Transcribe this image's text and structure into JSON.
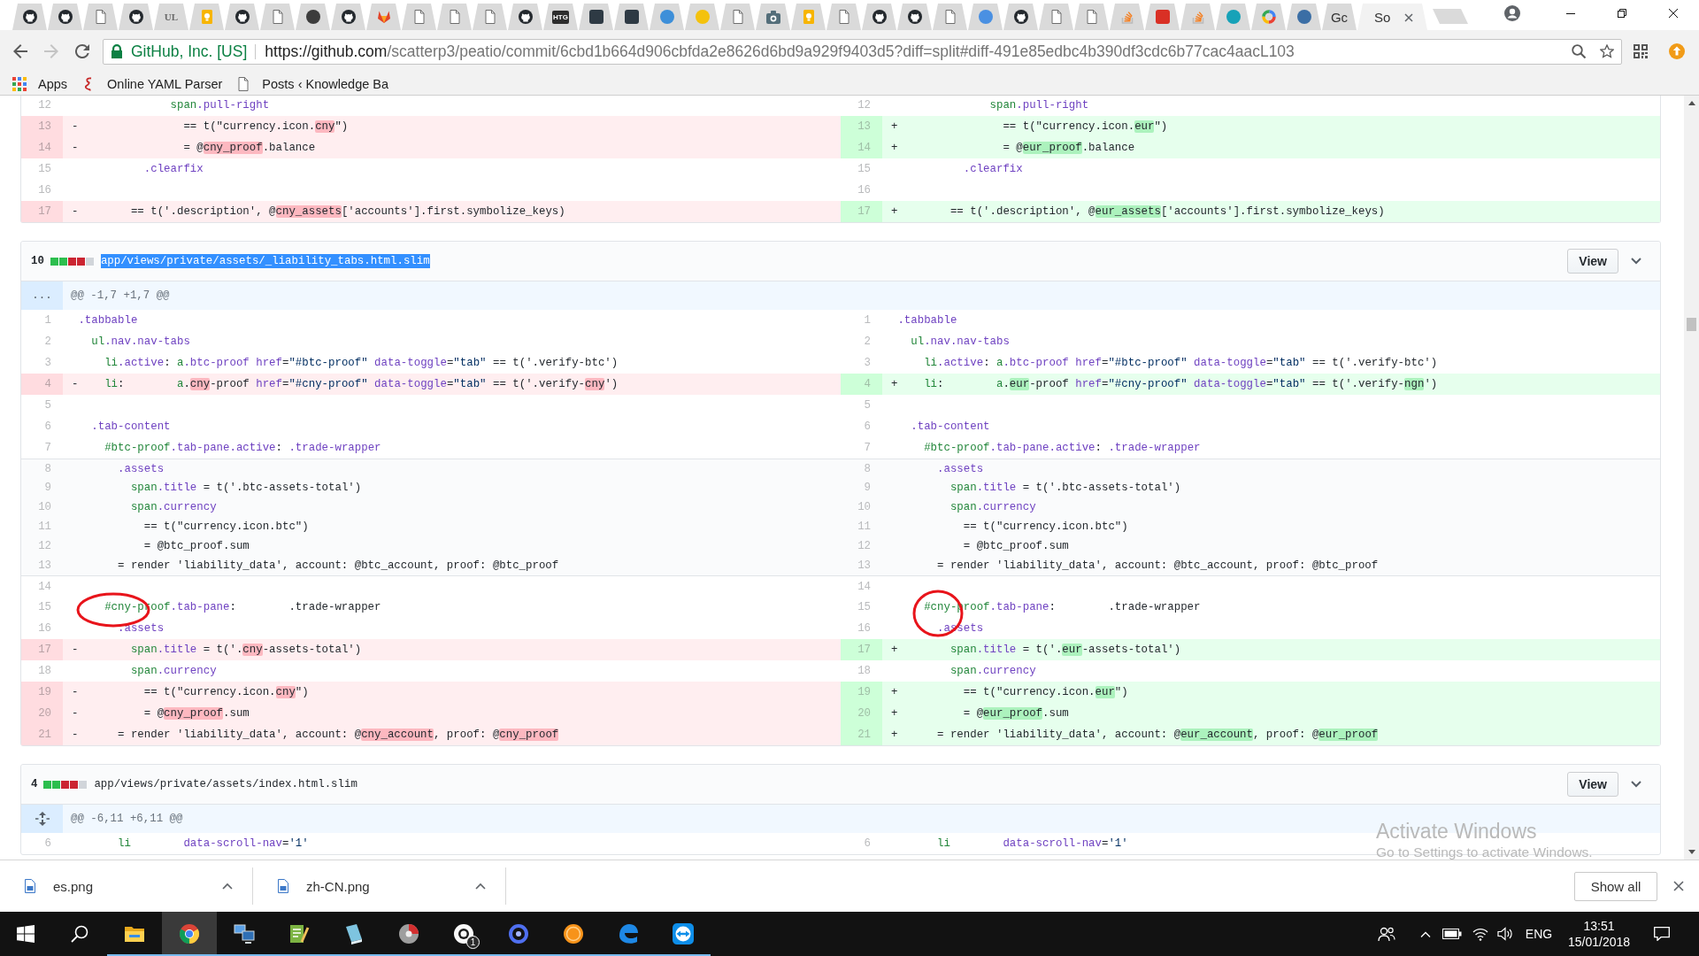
{
  "browser": {
    "tabs": [
      {
        "kind": "cat",
        "selected": false
      },
      {
        "kind": "cat",
        "selected": false
      },
      {
        "kind": "page",
        "selected": false
      },
      {
        "kind": "cat",
        "selected": false
      },
      {
        "kind": "letters",
        "glyph": "UL",
        "selected": false
      },
      {
        "kind": "note",
        "selected": false
      },
      {
        "kind": "cat",
        "selected": false
      },
      {
        "kind": "page",
        "selected": false
      },
      {
        "kind": "circle",
        "color": "#3c3c3c",
        "selected": false
      },
      {
        "kind": "cat",
        "selected": false
      },
      {
        "kind": "fox",
        "selected": false
      },
      {
        "kind": "page",
        "selected": false
      },
      {
        "kind": "page",
        "selected": false
      },
      {
        "kind": "page",
        "selected": false
      },
      {
        "kind": "cat",
        "selected": false
      },
      {
        "kind": "letters",
        "glyph": "HTG",
        "color": "#2d2d2d",
        "selected": false
      },
      {
        "kind": "square",
        "color": "#2e3a44",
        "selected": false
      },
      {
        "kind": "square",
        "color": "#2e3a44",
        "selected": false
      },
      {
        "kind": "circle",
        "color": "#3d8fd9",
        "selected": false
      },
      {
        "kind": "circle",
        "color": "#f4c20d",
        "selected": false
      },
      {
        "kind": "page",
        "selected": false
      },
      {
        "kind": "camera",
        "selected": false
      },
      {
        "kind": "note",
        "selected": false
      },
      {
        "kind": "page",
        "selected": false
      },
      {
        "kind": "cat",
        "selected": false
      },
      {
        "kind": "cat",
        "selected": false
      },
      {
        "kind": "page",
        "selected": false
      },
      {
        "kind": "circle",
        "color": "#4a90e2",
        "selected": false
      },
      {
        "kind": "cat",
        "selected": false
      },
      {
        "kind": "page",
        "selected": false
      },
      {
        "kind": "page",
        "selected": false
      },
      {
        "kind": "bars",
        "selected": false
      },
      {
        "kind": "square",
        "color": "#d93025",
        "selected": false
      },
      {
        "kind": "bars",
        "selected": false
      },
      {
        "kind": "circle",
        "color": "#17a2b8",
        "selected": false
      },
      {
        "kind": "ring",
        "selected": false
      },
      {
        "kind": "circle",
        "color": "#3b6ea5",
        "selected": false
      },
      {
        "kind": "text",
        "label": "Gc",
        "selected": false
      },
      {
        "kind": "text",
        "label": "So",
        "selected": true
      }
    ],
    "nav_buttons": [
      {
        "kind": "back",
        "disabled": false
      },
      {
        "kind": "forward",
        "disabled": true
      },
      {
        "kind": "reload",
        "disabled": false
      }
    ],
    "address_bar": {
      "secure_label": "GitHub, Inc. [US]",
      "url_host": "https://github.com",
      "url_path": "/scatterp3/peatio/commit/6cbd1b664d906cbfda2e8626d6bd9a929f9403d5?diff=split#diff-491e85edbc4b390df3cdc6b77cac4aacL103"
    },
    "bookmarks": [
      {
        "kind": "apps",
        "label": "Apps"
      },
      {
        "kind": "squiggle",
        "label": "Online YAML Parser"
      },
      {
        "kind": "page",
        "label": "Posts ‹ Knowledge Ba"
      }
    ]
  },
  "page": {
    "files": [
      {
        "rows": [
          {
            "left": {
              "number": "12",
              "kind": "context",
              "code": [
                {
                  "text": "              span",
                  "kind": "tag"
                },
                {
                  "text": ".pull-right",
                  "kind": "class"
                }
              ]
            },
            "right": {
              "number": "12",
              "kind": "context",
              "code": [
                {
                  "text": "              span",
                  "kind": "tag"
                },
                {
                  "text": ".pull-right",
                  "kind": "class"
                }
              ]
            },
            "circled": false
          },
          {
            "left": {
              "number": "13",
              "kind": "deletion",
              "marker": "-",
              "code": [
                "                == t(\"currency.icon.",
                {
                  "text": "cny",
                  "kind": "changed"
                },
                "\")"
              ]
            },
            "right": {
              "number": "13",
              "kind": "addition",
              "marker": "+",
              "code": [
                "                == t(\"currency.icon.",
                {
                  "text": "eur",
                  "kind": "changed"
                },
                "\")"
              ]
            },
            "circled": false
          },
          {
            "left": {
              "number": "14",
              "kind": "deletion",
              "marker": "-",
              "code": [
                "                = @",
                {
                  "text": "cny_proof",
                  "kind": "changed"
                },
                ".balance"
              ]
            },
            "right": {
              "number": "14",
              "kind": "addition",
              "marker": "+",
              "code": [
                "                = @",
                {
                  "text": "eur_proof",
                  "kind": "changed"
                },
                ".balance"
              ]
            },
            "circled": false
          },
          {
            "left": {
              "number": "15",
              "kind": "context",
              "code": [
                {
                  "text": "          .clearfix",
                  "kind": "class"
                }
              ]
            },
            "right": {
              "number": "15",
              "kind": "context",
              "code": [
                {
                  "text": "          .clearfix",
                  "kind": "class"
                }
              ]
            },
            "circled": false
          },
          {
            "left": {
              "number": "16",
              "kind": "context"
            },
            "right": {
              "number": "16",
              "kind": "context"
            },
            "circled": false
          },
          {
            "left": {
              "number": "17",
              "kind": "deletion",
              "marker": "-",
              "code": [
                "        == t('.description', @",
                {
                  "text": "cny_assets",
                  "kind": "changed"
                },
                "['accounts'].first.symbolize_keys)"
              ]
            },
            "right": {
              "number": "17",
              "kind": "addition",
              "marker": "+",
              "code": [
                "        == t('.description', @",
                {
                  "text": "eur_assets",
                  "kind": "changed"
                },
                "['accounts'].first.symbolize_keys)"
              ]
            },
            "circled": false
          }
        ]
      },
      {
        "header": {
          "change_count": "10",
          "diffstat": [
            {
              "color": "#2cbe4e"
            },
            {
              "color": "#2cbe4e"
            },
            {
              "color": "#cb2431"
            },
            {
              "color": "#cb2431"
            },
            {
              "color": "#d1d5da"
            }
          ],
          "path": "app/views/private/assets/_liability_tabs.html.slim",
          "text_selected": true,
          "view_button": "View"
        },
        "hunk": {
          "expander": {
            "kind": "ellipsis",
            "text": "..."
          },
          "text": "@@ -1,7 +1,7 @@"
        },
        "rows": [
          {
            "left": {
              "number": "1",
              "kind": "context",
              "code": [
                {
                  "text": ".tabbable",
                  "kind": "class"
                }
              ]
            },
            "right": {
              "number": "1",
              "kind": "context",
              "code": [
                {
                  "text": ".tabbable",
                  "kind": "class"
                }
              ]
            },
            "circled": false
          },
          {
            "left": {
              "number": "2",
              "kind": "context",
              "code": [
                {
                  "text": "  ul",
                  "kind": "tag"
                },
                {
                  "text": ".nav.nav-tabs",
                  "kind": "class"
                }
              ]
            },
            "right": {
              "number": "2",
              "kind": "context",
              "code": [
                {
                  "text": "  ul",
                  "kind": "tag"
                },
                {
                  "text": ".nav.nav-tabs",
                  "kind": "class"
                }
              ]
            },
            "circled": false
          },
          {
            "left": {
              "number": "3",
              "kind": "context",
              "code": [
                {
                  "text": "    li",
                  "kind": "tag"
                },
                {
                  "text": ".active",
                  "kind": "class"
                },
                ": ",
                {
                  "text": "a",
                  "kind": "tag"
                },
                {
                  "text": ".btc-proof",
                  "kind": "class"
                },
                {
                  "text": " href",
                  "kind": "class"
                },
                "=",
                {
                  "text": "\"#btc-proof\"",
                  "kind": "string"
                },
                {
                  "text": " data-toggle",
                  "kind": "class"
                },
                "=",
                {
                  "text": "\"tab\"",
                  "kind": "string"
                },
                " == t('.verify-btc')"
              ]
            },
            "right": {
              "number": "3",
              "kind": "context",
              "code": [
                {
                  "text": "    li",
                  "kind": "tag"
                },
                {
                  "text": ".active",
                  "kind": "class"
                },
                ": ",
                {
                  "text": "a",
                  "kind": "tag"
                },
                {
                  "text": ".btc-proof",
                  "kind": "class"
                },
                {
                  "text": " href",
                  "kind": "class"
                },
                "=",
                {
                  "text": "\"#btc-proof\"",
                  "kind": "string"
                },
                {
                  "text": " data-toggle",
                  "kind": "class"
                },
                "=",
                {
                  "text": "\"tab\"",
                  "kind": "string"
                },
                " == t('.verify-btc')"
              ]
            },
            "circled": false
          },
          {
            "left": {
              "number": "4",
              "kind": "deletion",
              "marker": "-",
              "code": [
                {
                  "text": "    li",
                  "kind": "tag"
                },
                ":        ",
                {
                  "text": "a",
                  "kind": "tag"
                },
                ".",
                {
                  "text": "cny",
                  "kind": "changed"
                },
                "-proof",
                {
                  "text": " href",
                  "kind": "class"
                },
                "=",
                {
                  "text": "\"#cny-proof\"",
                  "kind": "string"
                },
                {
                  "text": " data-toggle",
                  "kind": "class"
                },
                "=",
                {
                  "text": "\"tab\"",
                  "kind": "string"
                },
                " == t('.verify-",
                {
                  "text": "cny",
                  "kind": "changed"
                },
                "')"
              ]
            },
            "right": {
              "number": "4",
              "kind": "addition",
              "marker": "+",
              "code": [
                {
                  "text": "    li",
                  "kind": "tag"
                },
                ":        ",
                {
                  "text": "a",
                  "kind": "tag"
                },
                ".",
                {
                  "text": "eur",
                  "kind": "changed"
                },
                "-proof",
                {
                  "text": " href",
                  "kind": "class"
                },
                "=",
                {
                  "text": "\"#cny-proof\"",
                  "kind": "string"
                },
                {
                  "text": " data-toggle",
                  "kind": "class"
                },
                "=",
                {
                  "text": "\"tab\"",
                  "kind": "string"
                },
                " == t('.verify-",
                {
                  "text": "ngn",
                  "kind": "changed"
                },
                "')"
              ]
            },
            "circled": false
          },
          {
            "left": {
              "number": "5",
              "kind": "context"
            },
            "right": {
              "number": "5",
              "kind": "context"
            },
            "circled": false
          },
          {
            "left": {
              "number": "6",
              "kind": "context",
              "code": [
                {
                  "text": "  .tab-content",
                  "kind": "class"
                }
              ]
            },
            "right": {
              "number": "6",
              "kind": "context",
              "code": [
                {
                  "text": "  .tab-content",
                  "kind": "class"
                }
              ]
            },
            "circled": false
          },
          {
            "left": {
              "number": "7",
              "kind": "context",
              "code": [
                {
                  "text": "    #btc-proof",
                  "kind": "tag"
                },
                {
                  "text": ".tab-pane.active",
                  "kind": "class"
                },
                ": ",
                {
                  "text": ".trade-wrapper",
                  "kind": "class"
                }
              ]
            },
            "right": {
              "number": "7",
              "kind": "context",
              "code": [
                {
                  "text": "    #btc-proof",
                  "kind": "tag"
                },
                {
                  "text": ".tab-pane.active",
                  "kind": "class"
                },
                ": ",
                {
                  "text": ".trade-wrapper",
                  "kind": "class"
                }
              ]
            },
            "circled": false
          },
          {
            "left": {
              "number": "8",
              "kind": "expanded",
              "code": [
                {
                  "text": "      .assets",
                  "kind": "class"
                }
              ]
            },
            "right": {
              "number": "8",
              "kind": "expanded",
              "code": [
                {
                  "text": "      .assets",
                  "kind": "class"
                }
              ]
            },
            "circled": false
          },
          {
            "left": {
              "number": "9",
              "kind": "expanded",
              "code": [
                {
                  "text": "        span",
                  "kind": "tag"
                },
                {
                  "text": ".title",
                  "kind": "class"
                },
                " = t('.btc-assets-total')"
              ]
            },
            "right": {
              "number": "9",
              "kind": "expanded",
              "code": [
                {
                  "text": "        span",
                  "kind": "tag"
                },
                {
                  "text": ".title",
                  "kind": "class"
                },
                " = t('.btc-assets-total')"
              ]
            },
            "circled": false
          },
          {
            "left": {
              "number": "10",
              "kind": "expanded",
              "code": [
                {
                  "text": "        span",
                  "kind": "tag"
                },
                {
                  "text": ".currency",
                  "kind": "class"
                }
              ]
            },
            "right": {
              "number": "10",
              "kind": "expanded",
              "code": [
                {
                  "text": "        span",
                  "kind": "tag"
                },
                {
                  "text": ".currency",
                  "kind": "class"
                }
              ]
            },
            "circled": false
          },
          {
            "left": {
              "number": "11",
              "kind": "expanded",
              "code": [
                "          == t(\"currency.icon.btc\")"
              ]
            },
            "right": {
              "number": "11",
              "kind": "expanded",
              "code": [
                "          == t(\"currency.icon.btc\")"
              ]
            },
            "circled": false
          },
          {
            "left": {
              "number": "12",
              "kind": "expanded",
              "code": [
                "          = @btc_proof.sum"
              ]
            },
            "right": {
              "number": "12",
              "kind": "expanded",
              "code": [
                "          = @btc_proof.sum"
              ]
            },
            "circled": false
          },
          {
            "left": {
              "number": "13",
              "kind": "expanded",
              "code": [
                "      = render 'liability_data', account: @btc_account, proof: @btc_proof"
              ]
            },
            "right": {
              "number": "13",
              "kind": "expanded",
              "code": [
                "      = render 'liability_data', account: @btc_account, proof: @btc_proof"
              ]
            },
            "circled": false
          },
          {
            "left": {
              "number": "14",
              "kind": "context"
            },
            "right": {
              "number": "14",
              "kind": "context"
            },
            "circled": false
          },
          {
            "left": {
              "number": "15",
              "kind": "context",
              "code": [
                {
                  "text": "    #cny-proof",
                  "kind": "tag"
                },
                {
                  "text": ".tab-pane",
                  "kind": "class"
                },
                ":        .trade-wrapper"
              ]
            },
            "right": {
              "number": "15",
              "kind": "context",
              "code": [
                {
                  "text": "    #cny-proof",
                  "kind": "tag"
                },
                {
                  "text": ".tab-pane",
                  "kind": "class"
                },
                ":        .trade-wrapper"
              ]
            },
            "circled": true
          },
          {
            "left": {
              "number": "16",
              "kind": "context",
              "code": [
                {
                  "text": "      .assets",
                  "kind": "class"
                }
              ]
            },
            "right": {
              "number": "16",
              "kind": "context",
              "code": [
                {
                  "text": "      .assets",
                  "kind": "class"
                }
              ]
            },
            "circled": false
          },
          {
            "left": {
              "number": "17",
              "kind": "deletion",
              "marker": "-",
              "code": [
                {
                  "text": "        span",
                  "kind": "tag"
                },
                {
                  "text": ".title",
                  "kind": "class"
                },
                " = t('.",
                {
                  "text": "cny",
                  "kind": "changed"
                },
                "-assets-total')"
              ]
            },
            "right": {
              "number": "17",
              "kind": "addition",
              "marker": "+",
              "code": [
                {
                  "text": "        span",
                  "kind": "tag"
                },
                {
                  "text": ".title",
                  "kind": "class"
                },
                " = t('.",
                {
                  "text": "eur",
                  "kind": "changed"
                },
                "-assets-total')"
              ]
            },
            "circled": false
          },
          {
            "left": {
              "number": "18",
              "kind": "context",
              "code": [
                {
                  "text": "        span",
                  "kind": "tag"
                },
                {
                  "text": ".currency",
                  "kind": "class"
                }
              ]
            },
            "right": {
              "number": "18",
              "kind": "context",
              "code": [
                {
                  "text": "        span",
                  "kind": "tag"
                },
                {
                  "text": ".currency",
                  "kind": "class"
                }
              ]
            },
            "circled": false
          },
          {
            "left": {
              "number": "19",
              "kind": "deletion",
              "marker": "-",
              "code": [
                "          == t(\"currency.icon.",
                {
                  "text": "cny",
                  "kind": "changed"
                },
                "\")"
              ]
            },
            "right": {
              "number": "19",
              "kind": "addition",
              "marker": "+",
              "code": [
                "          == t(\"currency.icon.",
                {
                  "text": "eur",
                  "kind": "changed"
                },
                "\")"
              ]
            },
            "circled": false
          },
          {
            "left": {
              "number": "20",
              "kind": "deletion",
              "marker": "-",
              "code": [
                "          = @",
                {
                  "text": "cny_proof",
                  "kind": "changed"
                },
                ".sum"
              ]
            },
            "right": {
              "number": "20",
              "kind": "addition",
              "marker": "+",
              "code": [
                "          = @",
                {
                  "text": "eur_proof",
                  "kind": "changed"
                },
                ".sum"
              ]
            },
            "circled": false
          },
          {
            "left": {
              "number": "21",
              "kind": "deletion",
              "marker": "-",
              "code": [
                "      = render 'liability_data', account: @",
                {
                  "text": "cny_account",
                  "kind": "changed"
                },
                ", proof: @",
                {
                  "text": "cny_proof",
                  "kind": "changed"
                }
              ]
            },
            "right": {
              "number": "21",
              "kind": "addition",
              "marker": "+",
              "code": [
                "      = render 'liability_data', account: @",
                {
                  "text": "eur_account",
                  "kind": "changed"
                },
                ", proof: @",
                {
                  "text": "eur_proof",
                  "kind": "changed"
                }
              ]
            },
            "circled": false
          }
        ]
      },
      {
        "header": {
          "change_count": "4",
          "diffstat": [
            {
              "color": "#2cbe4e"
            },
            {
              "color": "#2cbe4e"
            },
            {
              "color": "#cb2431"
            },
            {
              "color": "#cb2431"
            },
            {
              "color": "#d1d5da"
            }
          ],
          "path": "app/views/private/assets/index.html.slim",
          "text_selected": false,
          "view_button": "View"
        },
        "hunk": {
          "expander": {
            "kind": "unfold"
          },
          "text": "@@ -6,11 +6,11 @@"
        },
        "rows": [
          {
            "left": {
              "number": "6",
              "kind": "context",
              "code": [
                {
                  "text": "      li",
                  "kind": "tag"
                },
                {
                  "text": "        data-scroll-nav",
                  "kind": "class"
                },
                "=",
                {
                  "text": "'1'",
                  "kind": "string"
                }
              ]
            },
            "right": {
              "number": "6",
              "kind": "context",
              "code": [
                {
                  "text": "      li",
                  "kind": "tag"
                },
                {
                  "text": "        data-scroll-nav",
                  "kind": "class"
                },
                "=",
                {
                  "text": "'1'",
                  "kind": "string"
                }
              ]
            },
            "circled": false
          }
        ]
      }
    ]
  },
  "activation_notice": {
    "title": "Activate Windows",
    "text": "Go to Settings to activate Windows."
  },
  "downloads": {
    "items": [
      {
        "file_name": "es.png"
      },
      {
        "file_name": "zh-CN.png"
      }
    ],
    "show_all": "Show all"
  },
  "taskbar": {
    "apps": [
      {
        "kind": "folder",
        "active": false,
        "running": true
      },
      {
        "kind": "tricolor",
        "active": true,
        "running": true
      },
      {
        "kind": "monitors",
        "active": false,
        "running": true
      },
      {
        "kind": "notepad",
        "active": false,
        "running": true
      },
      {
        "kind": "book",
        "active": false,
        "running": true
      },
      {
        "kind": "disc",
        "active": false,
        "running": true
      },
      {
        "kind": "chat",
        "badge": "1",
        "active": false,
        "running": true
      },
      {
        "kind": "ring",
        "active": false,
        "running": true
      },
      {
        "kind": "coin",
        "active": false,
        "running": true
      },
      {
        "kind": "arc",
        "active": false,
        "running": true
      },
      {
        "kind": "arrows",
        "active": false,
        "running": true
      }
    ],
    "tray": {
      "language": "ENG",
      "time": "13:51",
      "date": "15/01/2018"
    }
  }
}
